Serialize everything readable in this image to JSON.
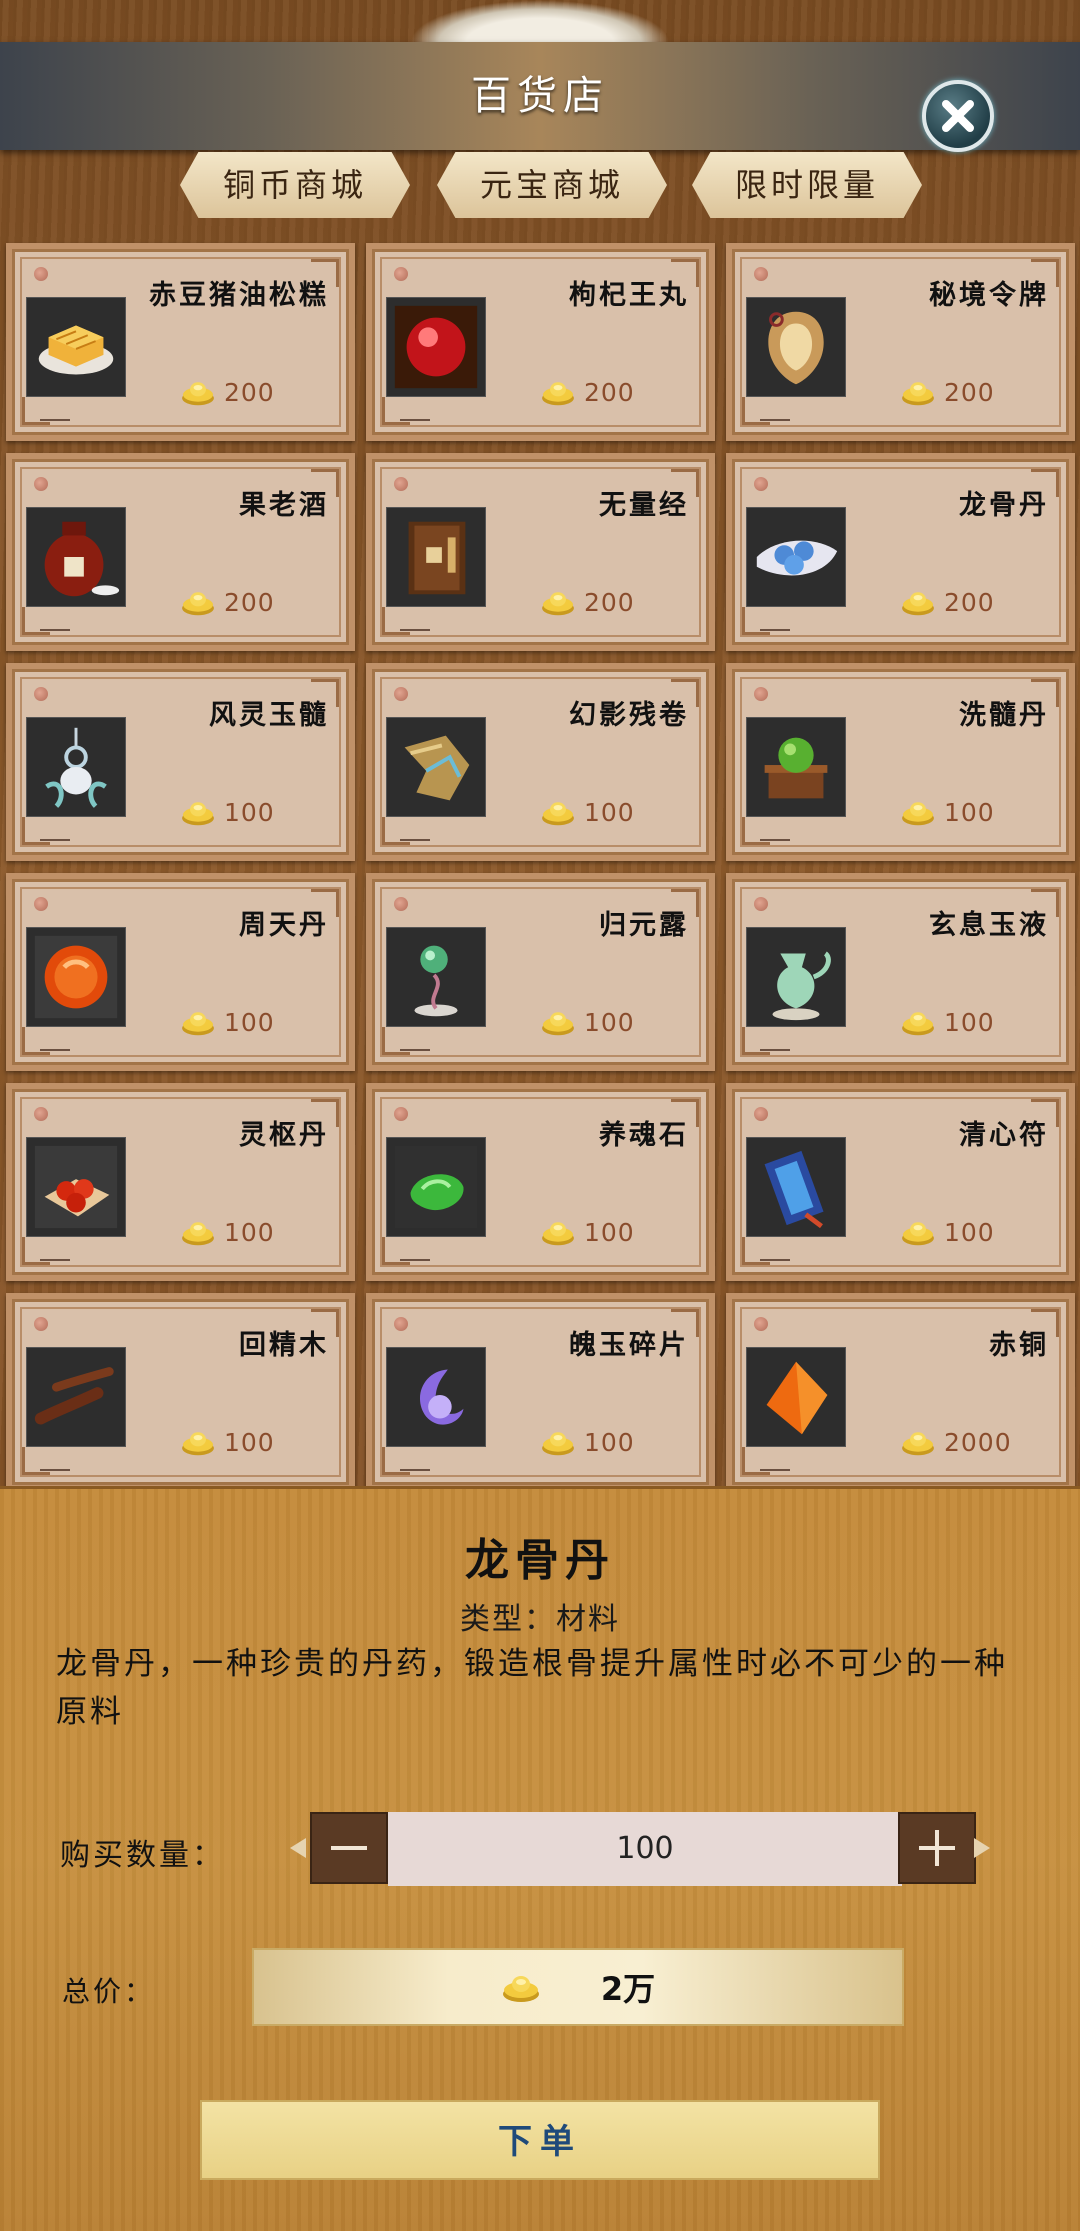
{
  "header": {
    "title": "百货店",
    "close_icon": "close-icon"
  },
  "tabs": [
    {
      "label": "铜币商城"
    },
    {
      "label": "元宝商城"
    },
    {
      "label": "限时限量"
    }
  ],
  "items": [
    {
      "name": "赤豆猪油松糕",
      "price": "200",
      "icon": "cake-icon"
    },
    {
      "name": "枸杞王丸",
      "price": "200",
      "icon": "red-pill-icon"
    },
    {
      "name": "秘境令牌",
      "price": "200",
      "icon": "token-icon"
    },
    {
      "name": "果老酒",
      "price": "200",
      "icon": "wine-jar-icon"
    },
    {
      "name": "无量经",
      "price": "200",
      "icon": "book-icon"
    },
    {
      "name": "龙骨丹",
      "price": "200",
      "icon": "bone-pill-icon"
    },
    {
      "name": "风灵玉髓",
      "price": "100",
      "icon": "jade-pendant-icon"
    },
    {
      "name": "幻影残卷",
      "price": "100",
      "icon": "scroll-fragment-icon"
    },
    {
      "name": "洗髓丹",
      "price": "100",
      "icon": "green-pill-box-icon"
    },
    {
      "name": "周天丹",
      "price": "100",
      "icon": "orange-pill-icon"
    },
    {
      "name": "归元露",
      "price": "100",
      "icon": "dew-icon"
    },
    {
      "name": "玄息玉液",
      "price": "100",
      "icon": "jade-ewer-icon"
    },
    {
      "name": "灵枢丹",
      "price": "100",
      "icon": "red-pills-icon"
    },
    {
      "name": "养魂石",
      "price": "100",
      "icon": "green-stone-icon"
    },
    {
      "name": "清心符",
      "price": "100",
      "icon": "talisman-icon"
    },
    {
      "name": "回精木",
      "price": "100",
      "icon": "wood-icon"
    },
    {
      "name": "魄玉碎片",
      "price": "100",
      "icon": "purple-shard-icon"
    },
    {
      "name": "赤铜",
      "price": "2000",
      "icon": "copper-icon"
    }
  ],
  "detail": {
    "title": "龙骨丹",
    "type": "类型：材料",
    "description": "龙骨丹，一种珍贵的丹药，锻造根骨提升属性时必不可少的一种原料",
    "quantity_label": "购买数量：",
    "quantity": "100",
    "total_label": "总价：",
    "total_value": "2万",
    "order_label": "下单"
  }
}
